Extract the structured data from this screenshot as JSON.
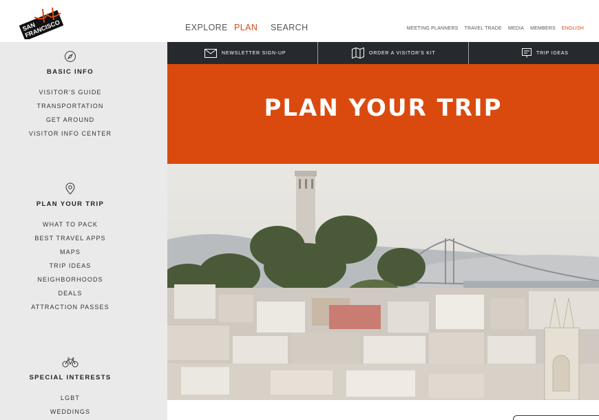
{
  "header": {
    "logo_text": [
      "SAN",
      "FRANCISCO"
    ],
    "main_nav": [
      {
        "label": "EXPLORE",
        "active": false
      },
      {
        "label": "PLAN",
        "active": true
      },
      {
        "label": "SEARCH",
        "active": false
      }
    ],
    "util_nav": [
      "MEETING PLANNERS",
      "TRAVEL TRADE",
      "MEDIA",
      "MEMBERS"
    ],
    "language": "ENGLISH"
  },
  "sidebar": {
    "sections": [
      {
        "icon": "compass-icon",
        "title": "BASIC INFO",
        "items": [
          "VISITOR'S GUIDE",
          "TRANSPORTATION",
          "GET AROUND",
          "VISITOR INFO CENTER"
        ]
      },
      {
        "icon": "map-pin-icon",
        "title": "PLAN YOUR TRIP",
        "items": [
          "WHAT TO PACK",
          "BEST TRAVEL APPS",
          "MAPS",
          "TRIP IDEAS",
          "NEIGHBORHOODS",
          "DEALS",
          "ATTRACTION PASSES"
        ]
      },
      {
        "icon": "bicycle-icon",
        "title": "SPECIAL INTERESTS",
        "items": [
          "LGBT",
          "WEDDINGS"
        ]
      }
    ]
  },
  "actionbar": [
    {
      "icon": "envelope-icon",
      "label": "NEWSLETTER SIGN-UP"
    },
    {
      "icon": "map-icon",
      "label": "ORDER A VISITOR'S KIT"
    },
    {
      "icon": "trip-ideas-icon",
      "label": "TRIP IDEAS"
    }
  ],
  "banner": {
    "title": "PLAN YOUR TRIP"
  },
  "colors": {
    "accent": "#da4a0e",
    "sidebar_bg": "#eaeaea",
    "actionbar_bg": "#262a2f"
  }
}
